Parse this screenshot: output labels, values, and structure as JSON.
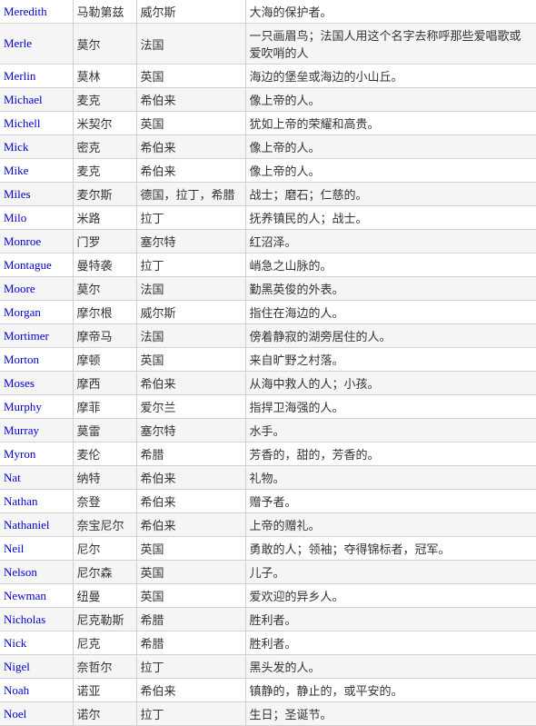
{
  "rows": [
    {
      "name": "Meredith",
      "chinese": "马勒第兹",
      "origin": "威尔斯",
      "meaning": "大海的保护者。"
    },
    {
      "name": "Merle",
      "chinese": "莫尔",
      "origin": "法国",
      "meaning": "一只画眉鸟；法国人用这个名字去称呼那些爱唱歌或爱吹哨的人"
    },
    {
      "name": "Merlin",
      "chinese": "莫林",
      "origin": "英国",
      "meaning": "海边的堡垒或海边的小山丘。"
    },
    {
      "name": "Michael",
      "chinese": "麦克",
      "origin": "希伯来",
      "meaning": "像上帝的人。"
    },
    {
      "name": "Michell",
      "chinese": "米契尔",
      "origin": "英国",
      "meaning": "犹如上帝的荣耀和高贵。"
    },
    {
      "name": "Mick",
      "chinese": "密克",
      "origin": "希伯来",
      "meaning": "像上帝的人。"
    },
    {
      "name": "Mike",
      "chinese": "麦克",
      "origin": "希伯来",
      "meaning": "像上帝的人。"
    },
    {
      "name": "Miles",
      "chinese": "麦尔斯",
      "origin": "德国，拉丁，希腊",
      "meaning": "战士；磨石；仁慈的。"
    },
    {
      "name": "Milo",
      "chinese": "米路",
      "origin": "拉丁",
      "meaning": "抚养镇民的人；战士。"
    },
    {
      "name": "Monroe",
      "chinese": "门罗",
      "origin": "塞尔特",
      "meaning": "红沼泽。"
    },
    {
      "name": "Montague",
      "chinese": "曼特袭",
      "origin": "拉丁",
      "meaning": "峭急之山脉的。"
    },
    {
      "name": "Moore",
      "chinese": "莫尔",
      "origin": "法国",
      "meaning": "勤黑英俊的外表。"
    },
    {
      "name": "Morgan",
      "chinese": "摩尔根",
      "origin": "威尔斯",
      "meaning": "指住在海边的人。"
    },
    {
      "name": "Mortimer",
      "chinese": "摩帝马",
      "origin": "法国",
      "meaning": "傍着静寂的湖旁居住的人。"
    },
    {
      "name": "Morton",
      "chinese": "摩顿",
      "origin": "英国",
      "meaning": "来自旷野之村落。"
    },
    {
      "name": "Moses",
      "chinese": "摩西",
      "origin": "希伯来",
      "meaning": "从海中救人的人；小孩。"
    },
    {
      "name": "Murphy",
      "chinese": "摩菲",
      "origin": "爱尔兰",
      "meaning": "指捍卫海强的人。"
    },
    {
      "name": "Murray",
      "chinese": "莫雷",
      "origin": "塞尔特",
      "meaning": "水手。"
    },
    {
      "name": "Myron",
      "chinese": "麦伦",
      "origin": "希腊",
      "meaning": "芳香的，甜的，芳香的。"
    },
    {
      "name": "Nat",
      "chinese": "纳特",
      "origin": "希伯来",
      "meaning": "礼物。"
    },
    {
      "name": "Nathan",
      "chinese": "奈登",
      "origin": "希伯来",
      "meaning": "赠予者。"
    },
    {
      "name": "Nathaniel",
      "chinese": "奈宝尼尔",
      "origin": "希伯来",
      "meaning": "上帝的赠礼。"
    },
    {
      "name": "Neil",
      "chinese": "尼尔",
      "origin": "英国",
      "meaning": "勇敢的人；领袖；夺得锦标者，冠军。"
    },
    {
      "name": "Nelson",
      "chinese": "尼尔森",
      "origin": "英国",
      "meaning": "儿子。"
    },
    {
      "name": "Newman",
      "chinese": "纽曼",
      "origin": "英国",
      "meaning": "爱欢迎的异乡人。"
    },
    {
      "name": "Nicholas",
      "chinese": "尼克勒斯",
      "origin": "希腊",
      "meaning": "胜利者。"
    },
    {
      "name": "Nick",
      "chinese": "尼克",
      "origin": "希腊",
      "meaning": "胜利者。"
    },
    {
      "name": "Nigel",
      "chinese": "奈哲尔",
      "origin": "拉丁",
      "meaning": "黑头发的人。"
    },
    {
      "name": "Noah",
      "chinese": "诺亚",
      "origin": "希伯来",
      "meaning": "镇静的，静止的，或平安的。"
    },
    {
      "name": "Noel",
      "chinese": "诺尔",
      "origin": "拉丁",
      "meaning": "生日；圣诞节。"
    }
  ]
}
